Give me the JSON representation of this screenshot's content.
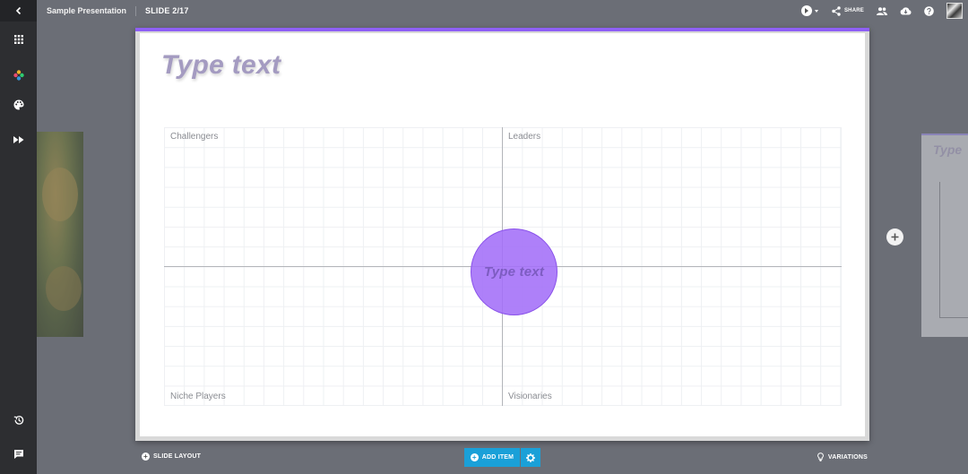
{
  "header": {
    "presentation_title": "Sample Presentation",
    "slide_indicator": "SLIDE 2/17",
    "share_label": "SHARE"
  },
  "sidebar": {
    "items": [
      {
        "name": "back",
        "icon": "chevron-left-icon"
      },
      {
        "name": "apps",
        "icon": "grid-icon"
      },
      {
        "name": "colors",
        "icon": "color-dots-icon"
      },
      {
        "name": "theme",
        "icon": "palette-icon"
      },
      {
        "name": "animations",
        "icon": "fast-forward-icon"
      },
      {
        "name": "history",
        "icon": "history-icon"
      },
      {
        "name": "comments",
        "icon": "comment-icon"
      }
    ]
  },
  "slide": {
    "title": "Type text",
    "quadrants": {
      "top_left": "Challengers",
      "top_right": "Leaders",
      "bottom_left": "Niche Players",
      "bottom_right": "Visionaries"
    },
    "bubble_text": "Type text",
    "accent_color": "#8e5ff5",
    "bubble_color": "#a36ef8"
  },
  "next_thumbnail": {
    "title": "Type"
  },
  "footer": {
    "slide_layout_label": "SLIDE LAYOUT",
    "add_item_label": "ADD ITEM",
    "variations_label": "VARIATIONS",
    "accent_color": "#1aa0d8"
  }
}
